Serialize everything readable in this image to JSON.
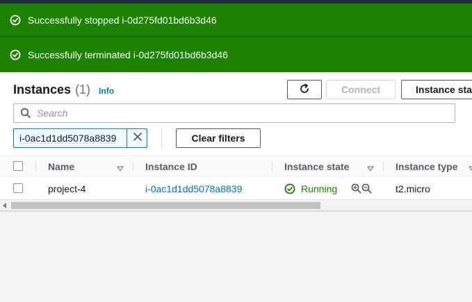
{
  "flash": [
    {
      "message": "Successfully stopped i-0d275fd01bd6b3d46",
      "icon": "success-check-icon"
    },
    {
      "message": "Successfully terminated i-0d275fd01bd6b3d46",
      "icon": "success-check-icon"
    }
  ],
  "header": {
    "title": "Instances",
    "count": "(1)",
    "info_label": "Info"
  },
  "toolbar": {
    "refresh_icon": "refresh-icon",
    "connect_label": "Connect",
    "instance_state_label": "Instance sta"
  },
  "search": {
    "placeholder": "Search",
    "value": ""
  },
  "filter": {
    "token": "i-0ac1d1dd5078a8839",
    "clear_label": "Clear filters"
  },
  "table": {
    "columns": [
      "Name",
      "Instance ID",
      "Instance state",
      "Instance type"
    ],
    "rows": [
      {
        "name": "project-4",
        "instance_id": "i-0ac1d1dd5078a8839",
        "state": "Running",
        "type": "t2.micro"
      }
    ]
  },
  "colors": {
    "success": "#1d8102",
    "link": "#0073bb",
    "header_dark": "#232f3e"
  }
}
